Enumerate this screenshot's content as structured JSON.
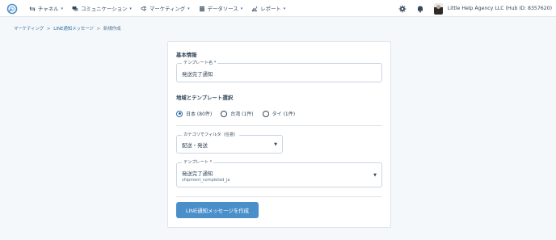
{
  "nav": {
    "items": [
      {
        "label": "チャネル",
        "icon": "channel-icon"
      },
      {
        "label": "コミュニケーション",
        "icon": "chat-icon"
      },
      {
        "label": "マーケティング",
        "icon": "megaphone-icon"
      },
      {
        "label": "データソース",
        "icon": "database-icon"
      },
      {
        "label": "レポート",
        "icon": "report-icon"
      }
    ],
    "account": "Little Help Agency LLC (Hub ID: 8357620)"
  },
  "breadcrumb": {
    "items": [
      "マーケティング",
      "LINE通知メッセージ"
    ],
    "current": "新規作成",
    "separator": ">"
  },
  "form": {
    "basic_title": "基本情報",
    "template_name": {
      "label": "テンプレート名 *",
      "value": "発送完了通知"
    },
    "region_title": "地域とテンプレート選択",
    "regions": [
      {
        "label": "日本 (80件)",
        "checked": true
      },
      {
        "label": "台湾 (1件)",
        "checked": false
      },
      {
        "label": "タイ (1件)",
        "checked": false
      }
    ],
    "category": {
      "label": "カテゴリでフィルタ（任意）",
      "value": "配送・発送"
    },
    "template": {
      "label": "テンプレート *",
      "value": "発送完了通知",
      "sub": "shipment_completed_ja"
    },
    "submit_label": "LINE通知メッセージを作成"
  },
  "colors": {
    "accent": "#4a8fc9",
    "link": "#2d6da8",
    "text": "#33475b"
  }
}
